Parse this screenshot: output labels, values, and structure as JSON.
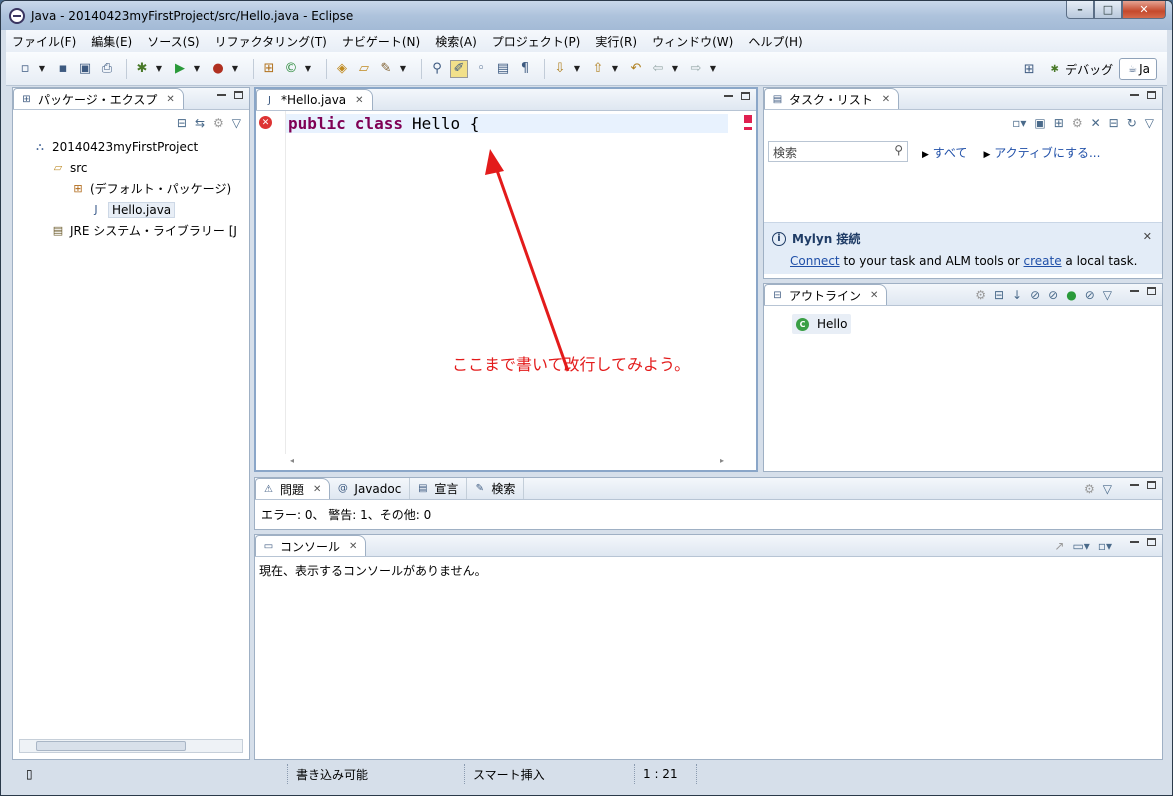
{
  "window": {
    "title": "Java - 20140423myFirstProject/src/Hello.java - Eclipse",
    "min": "–",
    "max": "□",
    "close": "✕"
  },
  "menu": [
    "ファイル(F)",
    "編集(E)",
    "ソース(S)",
    "リファクタリング(T)",
    "ナビゲート(N)",
    "検索(A)",
    "プロジェクト(P)",
    "実行(R)",
    "ウィンドウ(W)",
    "ヘルプ(H)"
  ],
  "perspectives": {
    "debug": "デバッグ",
    "java": "Ja"
  },
  "package_explorer": {
    "tab": "パッケージ・エクスプ",
    "tree": {
      "project": "20140423myFirstProject",
      "src": "src",
      "package": "(デフォルト・パッケージ)",
      "file": "Hello.java",
      "jre": "JRE システム・ライブラリー [J"
    }
  },
  "editor": {
    "tab": "*Hello.java",
    "code": {
      "kw1": "public",
      "kw2": "class",
      "rest": "Hello {"
    },
    "annotation": "ここまで書いて改行してみよう。",
    "annotation_color": "#e31b1b"
  },
  "task_list": {
    "tab": "タスク・リスト",
    "search_placeholder": "検索",
    "all_link": "すべて",
    "active_link": "アクティブにする...",
    "mylyn_title": "Mylyn 接続",
    "mylyn_connect": "Connect",
    "mylyn_middle": " to your task and ALM tools or ",
    "mylyn_create": "create",
    "mylyn_end": " a local task."
  },
  "outline": {
    "tab": "アウトライン",
    "item": "Hello"
  },
  "bottom_tabs": {
    "problems": "問題",
    "javadoc": "Javadoc",
    "declaration": "宣言",
    "search": "検索"
  },
  "problems": {
    "summary": "エラー: 0、 警告: 1、その他: 0"
  },
  "console": {
    "tab": "コンソール",
    "message": "現在、表示するコンソールがありません。"
  },
  "status": {
    "writable": "書き込み可能",
    "insert": "スマート挿入",
    "position": "1 : 21"
  }
}
